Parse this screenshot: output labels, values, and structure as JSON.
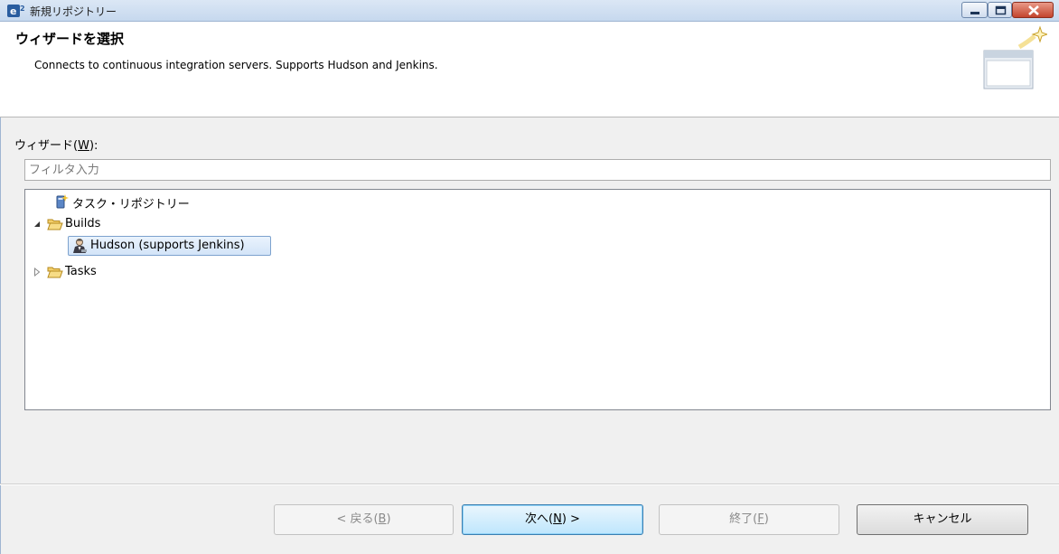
{
  "window": {
    "title": "新規リポジトリー",
    "controls": [
      "minimize",
      "maximize",
      "close"
    ]
  },
  "header": {
    "title": "ウィザードを選択",
    "description": "Connects to continuous integration servers. Supports Hudson and Jenkins."
  },
  "wizard": {
    "label_prefix": "ウィザード(",
    "label_mnemonic": "W",
    "label_suffix": "):",
    "filter_placeholder": "フィルタ入力",
    "filter_value": ""
  },
  "tree": {
    "items": [
      {
        "label": "タスク・リポジトリー",
        "icon": "task-repository-icon",
        "expandable": false,
        "depth": 0
      },
      {
        "label": "Builds",
        "icon": "folder-open-icon",
        "expandable": true,
        "expanded": true,
        "depth": 0
      },
      {
        "label": "Hudson (supports Jenkins)",
        "icon": "hudson-butler-icon",
        "expandable": false,
        "depth": 1,
        "selected": true
      },
      {
        "label": "Tasks",
        "icon": "folder-open-icon",
        "expandable": true,
        "expanded": false,
        "depth": 0
      }
    ]
  },
  "buttons": {
    "back": {
      "pre": "< 戻る(",
      "key": "B",
      "post": ")",
      "enabled": false
    },
    "next": {
      "pre": "次へ(",
      "key": "N",
      "post": ") >",
      "enabled": true,
      "default": true
    },
    "finish": {
      "pre": "終了(",
      "key": "F",
      "post": ")",
      "enabled": false
    },
    "cancel": {
      "label": "キャンセル",
      "enabled": true
    }
  },
  "colors": {
    "titlebar": "#c6d8ee",
    "close_button": "#c3442d",
    "selection": "#d3e4f8",
    "folder": "#e8b84a"
  }
}
